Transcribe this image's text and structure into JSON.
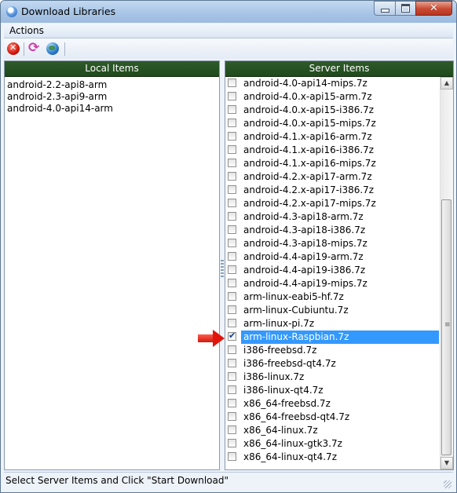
{
  "window": {
    "title": "Download Libraries",
    "minimize_glyph": "",
    "close_glyph": "✕"
  },
  "menu": {
    "actions_label": "Actions"
  },
  "toolbar": {
    "icons": [
      "stop-icon",
      "refresh-icon",
      "globe-icon"
    ]
  },
  "local_panel": {
    "header": "Local Items",
    "items": [
      "android-2.2-api8-arm",
      "android-2.3-api9-arm",
      "android-4.0-api14-arm"
    ]
  },
  "server_panel": {
    "header": "Server Items",
    "items": [
      {
        "label": "android-4.0-api14-mips.7z",
        "checked": false,
        "selected": false
      },
      {
        "label": "android-4.0.x-api15-arm.7z",
        "checked": false,
        "selected": false
      },
      {
        "label": "android-4.0.x-api15-i386.7z",
        "checked": false,
        "selected": false
      },
      {
        "label": "android-4.0.x-api15-mips.7z",
        "checked": false,
        "selected": false
      },
      {
        "label": "android-4.1.x-api16-arm.7z",
        "checked": false,
        "selected": false
      },
      {
        "label": "android-4.1.x-api16-i386.7z",
        "checked": false,
        "selected": false
      },
      {
        "label": "android-4.1.x-api16-mips.7z",
        "checked": false,
        "selected": false
      },
      {
        "label": "android-4.2.x-api17-arm.7z",
        "checked": false,
        "selected": false
      },
      {
        "label": "android-4.2.x-api17-i386.7z",
        "checked": false,
        "selected": false
      },
      {
        "label": "android-4.2.x-api17-mips.7z",
        "checked": false,
        "selected": false
      },
      {
        "label": "android-4.3-api18-arm.7z",
        "checked": false,
        "selected": false
      },
      {
        "label": "android-4.3-api18-i386.7z",
        "checked": false,
        "selected": false
      },
      {
        "label": "android-4.3-api18-mips.7z",
        "checked": false,
        "selected": false
      },
      {
        "label": "android-4.4-api19-arm.7z",
        "checked": false,
        "selected": false
      },
      {
        "label": "android-4.4-api19-i386.7z",
        "checked": false,
        "selected": false
      },
      {
        "label": "android-4.4-api19-mips.7z",
        "checked": false,
        "selected": false
      },
      {
        "label": "arm-linux-eabi5-hf.7z",
        "checked": false,
        "selected": false
      },
      {
        "label": "arm-linux-Cubiuntu.7z",
        "checked": false,
        "selected": false
      },
      {
        "label": "arm-linux-pi.7z",
        "checked": false,
        "selected": false
      },
      {
        "label": "arm-linux-Raspbian.7z",
        "checked": true,
        "selected": true
      },
      {
        "label": "i386-freebsd.7z",
        "checked": false,
        "selected": false
      },
      {
        "label": "i386-freebsd-qt4.7z",
        "checked": false,
        "selected": false
      },
      {
        "label": "i386-linux.7z",
        "checked": false,
        "selected": false
      },
      {
        "label": "i386-linux-qt4.7z",
        "checked": false,
        "selected": false
      },
      {
        "label": "x86_64-freebsd.7z",
        "checked": false,
        "selected": false
      },
      {
        "label": "x86_64-freebsd-qt4.7z",
        "checked": false,
        "selected": false
      },
      {
        "label": "x86_64-linux.7z",
        "checked": false,
        "selected": false
      },
      {
        "label": "x86_64-linux-gtk3.7z",
        "checked": false,
        "selected": false
      },
      {
        "label": "x86_64-linux-qt4.7z",
        "checked": false,
        "selected": false
      }
    ]
  },
  "status": {
    "text": "Select Server Items and Click \"Start Download\""
  },
  "colors": {
    "panel_header_bg": "#1f4a1c",
    "selection_bg": "#3399ff",
    "arrow": "#e0160c"
  }
}
